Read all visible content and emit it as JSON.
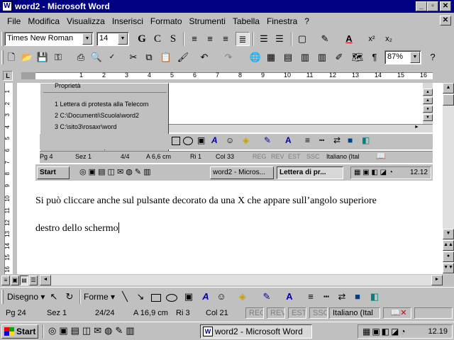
{
  "window": {
    "title": "word2 - Microsoft Word"
  },
  "menu": [
    "File",
    "Modifica",
    "Visualizza",
    "Inserisci",
    "Formato",
    "Strumenti",
    "Tabella",
    "Finestra",
    "?"
  ],
  "formatting": {
    "font": "Times New Roman",
    "size": "14",
    "bold": "G",
    "italic": "C",
    "underline": "S"
  },
  "standard": {
    "zoom": "87%"
  },
  "ruler": {
    "numbers": [
      "1",
      "2",
      "3",
      "4",
      "5",
      "6",
      "7",
      "8",
      "9",
      "10",
      "11",
      "12",
      "13",
      "14",
      "15",
      "16"
    ]
  },
  "vruler": {
    "numbers": [
      "1",
      "2",
      "3",
      "4",
      "5",
      "6",
      "7",
      "8",
      "9",
      "10",
      "11",
      "12",
      "13",
      "14",
      "15",
      "16"
    ]
  },
  "embedded": {
    "menu_title": "Proprietà",
    "recent": [
      "1 Lettera di protesta alla Telecom",
      "2 C:\\Documenti\\Scuola\\word2",
      "3 C:\\sito3\\rosaxr\\word"
    ],
    "status": {
      "pg": "Pg 4",
      "sez": "Sez 1",
      "pages": "4/4",
      "pos": "A 6,6 cm",
      "ri": "Ri 1",
      "col": "Col 33",
      "reg": "REG",
      "rev": "REV",
      "est": "EST",
      "ssc": "SSC",
      "lang": "Italiano (Ital"
    },
    "taskbar": {
      "start": "Start",
      "btn1": "word2 - Micros...",
      "btn2": "Lettera di pr...",
      "clock": "12.12"
    }
  },
  "document": {
    "line1": "Si può cliccare anche sul pulsante decorato da una X che appare sull’angolo superiore",
    "line2": "destro dello schermo"
  },
  "drawing": {
    "disegno": "Disegno",
    "forme": "Forme"
  },
  "status": {
    "pg": "Pg 24",
    "sez": "Sez 1",
    "pages": "24/24",
    "pos": "A 16,9 cm",
    "ri": "Ri 3",
    "col": "Col 21",
    "reg": "REG",
    "rev": "REV",
    "est": "EST",
    "ssc": "SSC",
    "lang": "Italiano (Ital"
  },
  "taskbar": {
    "start": "Start",
    "task": "word2 - Microsoft Word",
    "clock": "12.19"
  }
}
